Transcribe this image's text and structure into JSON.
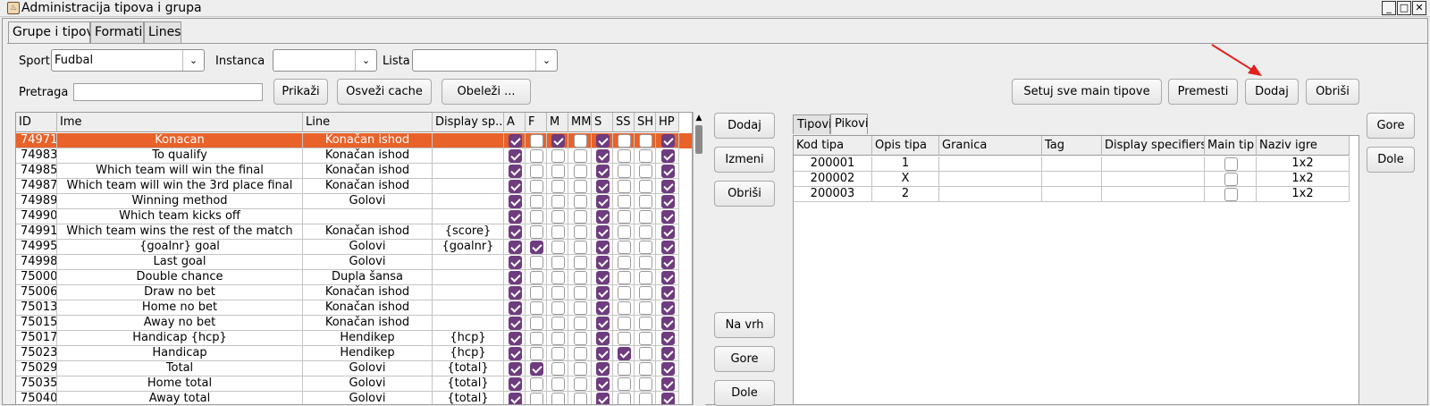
{
  "window": {
    "title": "Administracija tipova i grupa",
    "icon": "java-app-icon"
  },
  "tabs": [
    {
      "label": "Grupe i tipovi",
      "active": true
    },
    {
      "label": "Formati",
      "active": false
    },
    {
      "label": "Lines",
      "active": false
    }
  ],
  "filters": {
    "sport_label": "Sport",
    "sport_value": "Fudbal",
    "instanca_label": "Instanca",
    "instanca_value": "",
    "lista_label": "Lista",
    "lista_value": "",
    "pretraga_label": "Pretraga",
    "pretraga_value": ""
  },
  "toolbar": {
    "prikazi": "Prikaži",
    "osvezi": "Osveži cache",
    "obelezi": "Obeleži ...",
    "setuj": "Setuj sve main tipove",
    "premesti": "Premesti",
    "dodaj": "Dodaj",
    "obrisi": "Obriši"
  },
  "left_table": {
    "columns": [
      "ID",
      "Ime",
      "Line",
      "Display sp...",
      "A",
      "F",
      "M",
      "MM",
      "S",
      "SS",
      "SH",
      "HP"
    ],
    "rows": [
      {
        "id": "74971",
        "ime": "Konacan",
        "line": "Konačan ishod",
        "disp": "",
        "flags": [
          1,
          0,
          1,
          0,
          1,
          0,
          0,
          1
        ],
        "selected": true
      },
      {
        "id": "74983",
        "ime": "To qualify",
        "line": "Konačan ishod",
        "disp": "",
        "flags": [
          1,
          0,
          0,
          0,
          1,
          0,
          0,
          1
        ]
      },
      {
        "id": "74985",
        "ime": "Which team will win the final",
        "line": "Konačan ishod",
        "disp": "",
        "flags": [
          1,
          0,
          0,
          0,
          1,
          0,
          0,
          1
        ]
      },
      {
        "id": "74987",
        "ime": "Which team will win the 3rd place final",
        "line": "Konačan ishod",
        "disp": "",
        "flags": [
          1,
          0,
          0,
          0,
          1,
          0,
          0,
          1
        ]
      },
      {
        "id": "74989",
        "ime": "Winning method",
        "line": "Golovi",
        "disp": "",
        "flags": [
          1,
          0,
          0,
          0,
          1,
          0,
          0,
          1
        ]
      },
      {
        "id": "74990",
        "ime": "Which team kicks off",
        "line": "",
        "disp": "",
        "flags": [
          1,
          0,
          0,
          0,
          1,
          0,
          0,
          1
        ]
      },
      {
        "id": "74991",
        "ime": "Which team wins the rest of the match",
        "line": "Konačan ishod",
        "disp": "{score}",
        "flags": [
          1,
          0,
          0,
          0,
          1,
          0,
          0,
          1
        ]
      },
      {
        "id": "74995",
        "ime": "{goalnr} goal",
        "line": "Golovi",
        "disp": "{goalnr}",
        "flags": [
          1,
          1,
          0,
          0,
          1,
          0,
          0,
          1
        ]
      },
      {
        "id": "74998",
        "ime": "Last goal",
        "line": "Golovi",
        "disp": "",
        "flags": [
          1,
          0,
          0,
          0,
          1,
          0,
          0,
          1
        ]
      },
      {
        "id": "75000",
        "ime": "Double chance",
        "line": "Dupla šansa",
        "disp": "",
        "flags": [
          1,
          0,
          0,
          0,
          1,
          0,
          0,
          1
        ]
      },
      {
        "id": "75006",
        "ime": "Draw no bet",
        "line": "Konačan ishod",
        "disp": "",
        "flags": [
          1,
          0,
          0,
          0,
          1,
          0,
          0,
          1
        ]
      },
      {
        "id": "75013",
        "ime": "Home no bet",
        "line": "Konačan ishod",
        "disp": "",
        "flags": [
          1,
          0,
          0,
          0,
          1,
          0,
          0,
          1
        ]
      },
      {
        "id": "75015",
        "ime": "Away no bet",
        "line": "Konačan ishod",
        "disp": "",
        "flags": [
          1,
          0,
          0,
          0,
          1,
          0,
          0,
          1
        ]
      },
      {
        "id": "75017",
        "ime": "Handicap {hcp}",
        "line": "Hendikep",
        "disp": "{hcp}",
        "flags": [
          1,
          0,
          0,
          0,
          1,
          0,
          0,
          1
        ]
      },
      {
        "id": "75023",
        "ime": "Handicap",
        "line": "Hendikep",
        "disp": "{hcp}",
        "flags": [
          1,
          0,
          0,
          0,
          1,
          1,
          0,
          1
        ]
      },
      {
        "id": "75029",
        "ime": "Total",
        "line": "Golovi",
        "disp": "{total}",
        "flags": [
          1,
          1,
          0,
          0,
          1,
          0,
          0,
          1
        ]
      },
      {
        "id": "75035",
        "ime": "Home total",
        "line": "Golovi",
        "disp": "{total}",
        "flags": [
          1,
          0,
          0,
          0,
          1,
          0,
          0,
          1
        ]
      },
      {
        "id": "75040",
        "ime": "Away total",
        "line": "Golovi",
        "disp": "{total}",
        "flags": [
          1,
          0,
          0,
          0,
          1,
          0,
          0,
          1
        ]
      }
    ]
  },
  "middle_buttons": {
    "dodaj": "Dodaj",
    "izmeni": "Izmeni",
    "obrisi": "Obriši",
    "na_vrh": "Na vrh",
    "gore": "Gore",
    "dole": "Dole"
  },
  "right_tabs": [
    {
      "label": "Tipovi",
      "active": false
    },
    {
      "label": "Pikovi",
      "active": true
    }
  ],
  "right_table": {
    "columns": [
      "Kod tipa",
      "Opis tipa",
      "Granica",
      "Tag",
      "Display specifiers",
      "Main tip",
      "Naziv igre"
    ],
    "rows": [
      {
        "kod": "200001",
        "opis": "1",
        "granica": "",
        "tag": "",
        "disp": "",
        "main": false,
        "naziv": "1x2"
      },
      {
        "kod": "200002",
        "opis": "X",
        "granica": "",
        "tag": "",
        "disp": "",
        "main": false,
        "naziv": "1x2"
      },
      {
        "kod": "200003",
        "opis": "2",
        "granica": "",
        "tag": "",
        "disp": "",
        "main": false,
        "naziv": "1x2"
      }
    ]
  },
  "right_buttons": {
    "gore": "Gore",
    "dole": "Dole"
  },
  "colors": {
    "selection": "#e8622a",
    "checkbox_checked": "#6e3c7f",
    "annotation_arrow": "#e0201c"
  }
}
